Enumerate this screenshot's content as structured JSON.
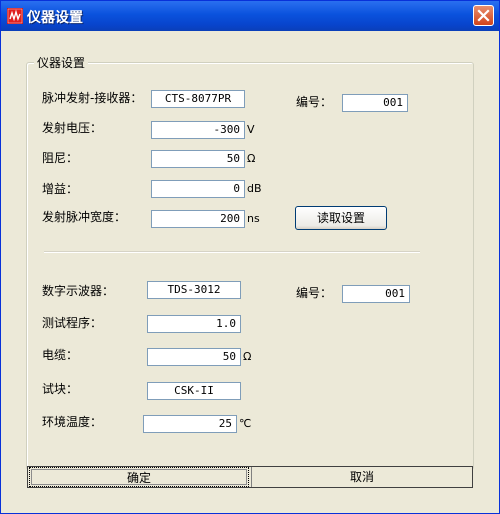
{
  "window": {
    "title": "仪器设置",
    "icons": {
      "app": "instrument-app-icon",
      "close": "close-icon"
    }
  },
  "group": {
    "title": "仪器设置"
  },
  "pulser": {
    "label": "脉冲发射-接收器：",
    "value": "CTS-8077PR",
    "serial_label": "编号：",
    "serial_value": "001",
    "voltage_label": "发射电压：",
    "voltage_value": "-300",
    "voltage_unit": "V",
    "damping_label": "阻尼：",
    "damping_value": "50",
    "damping_unit": "Ω",
    "gain_label": "增益：",
    "gain_value": "0",
    "gain_unit": "dB",
    "width_label": "发射脉冲宽度：",
    "width_value": "200",
    "width_unit": "ns",
    "read_button": "读取设置"
  },
  "scope": {
    "label": "数字示波器：",
    "value": "TDS-3012",
    "serial_label": "编号：",
    "serial_value": "001",
    "program_label": "测试程序：",
    "program_value": "1.0",
    "cable_label": "电缆：",
    "cable_value": "50",
    "cable_unit": "Ω",
    "block_label": "试块：",
    "block_value": "CSK-II",
    "temp_label": "环境温度：",
    "temp_value": "25",
    "temp_unit": "℃"
  },
  "buttons": {
    "ok": "确定",
    "cancel": "取消"
  }
}
